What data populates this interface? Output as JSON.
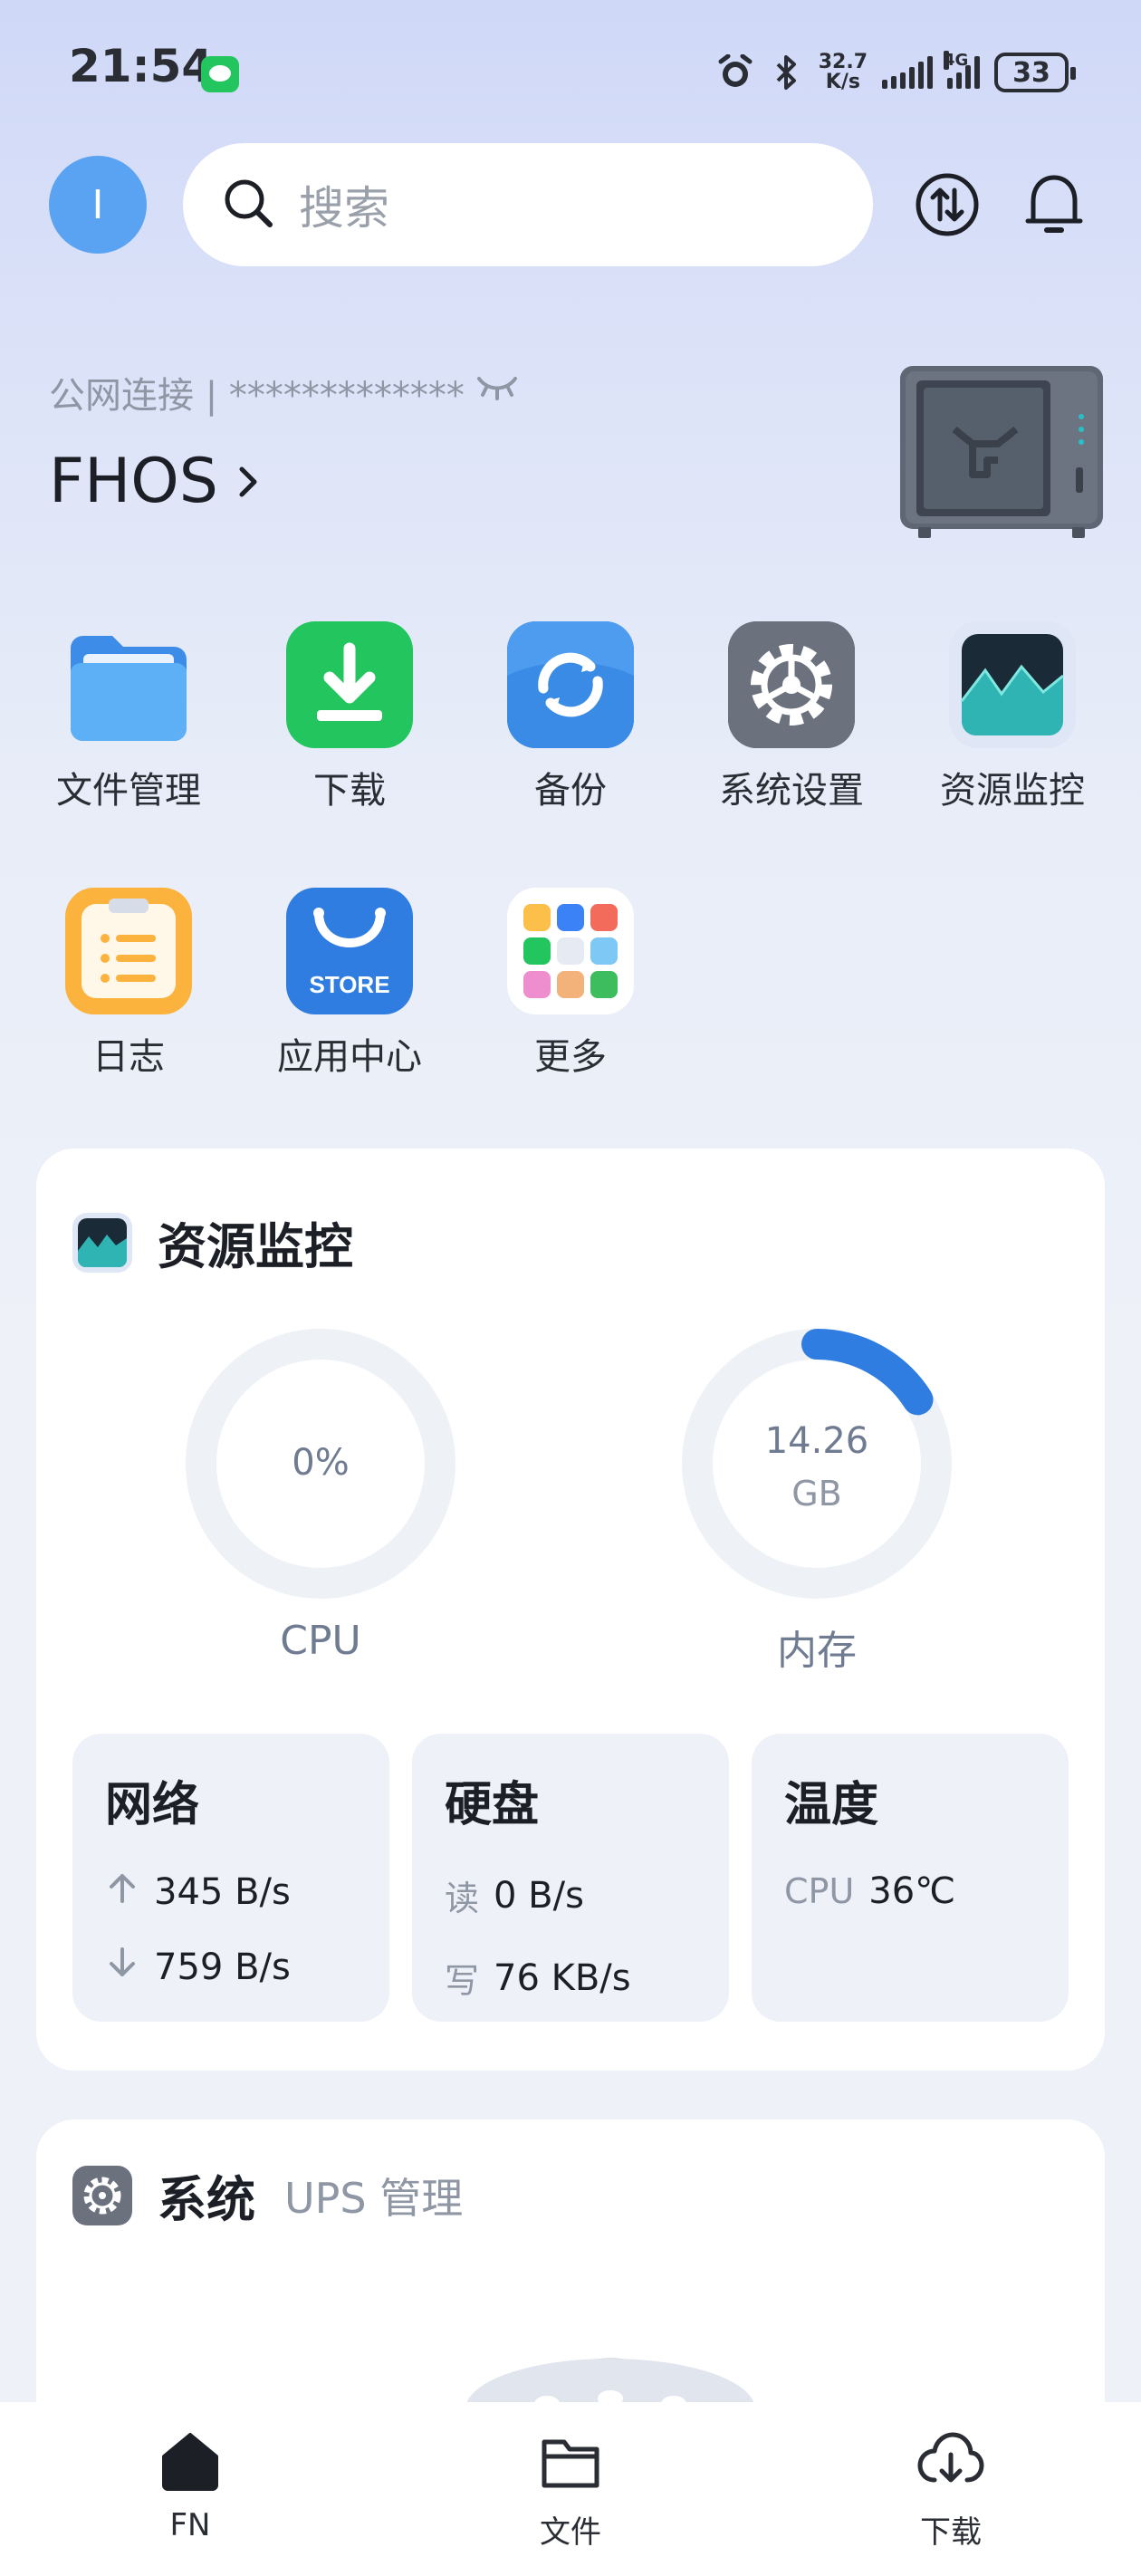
{
  "status_bar": {
    "time": "21:54",
    "net_speed_value": "32.7",
    "net_speed_unit": "K/s",
    "network_type": "4G",
    "battery": "33"
  },
  "header": {
    "avatar_letter": "I",
    "search_placeholder": "搜索"
  },
  "server": {
    "connection_label": "公网连接 | *************",
    "name": "FHOS"
  },
  "apps": [
    {
      "label": "文件管理",
      "icon": "folder-icon"
    },
    {
      "label": "下载",
      "icon": "download-icon"
    },
    {
      "label": "备份",
      "icon": "backup-icon"
    },
    {
      "label": "系统设置",
      "icon": "settings-icon"
    },
    {
      "label": "资源监控",
      "icon": "monitor-icon"
    },
    {
      "label": "日志",
      "icon": "log-icon"
    },
    {
      "label": "应用中心",
      "icon": "store-icon"
    },
    {
      "label": "更多",
      "icon": "more-icon"
    }
  ],
  "store_badge": "STORE",
  "resource_card": {
    "title": "资源监控",
    "cpu": {
      "value": "0%",
      "label": "CPU",
      "fraction": 0.0
    },
    "memory": {
      "value": "14.26",
      "unit": "GB",
      "label": "内存",
      "fraction": 0.16
    },
    "network": {
      "title": "网络",
      "up": "345 B/s",
      "down": "759 B/s"
    },
    "disk": {
      "title": "硬盘",
      "read_label": "读",
      "read": "0 B/s",
      "write_label": "写",
      "write": "76 KB/s"
    },
    "temperature": {
      "title": "温度",
      "cpu_label": "CPU",
      "cpu_value": "36℃"
    }
  },
  "system_card": {
    "title": "系统",
    "subtitle": "UPS 管理"
  },
  "bottom_nav": [
    {
      "label": "FN",
      "icon": "home-icon"
    },
    {
      "label": "文件",
      "icon": "folder-outline-icon"
    },
    {
      "label": "下载",
      "icon": "cloud-download-icon"
    }
  ],
  "colors": {
    "accent": "#2f7de1",
    "gauge_track": "#eef1f6"
  }
}
